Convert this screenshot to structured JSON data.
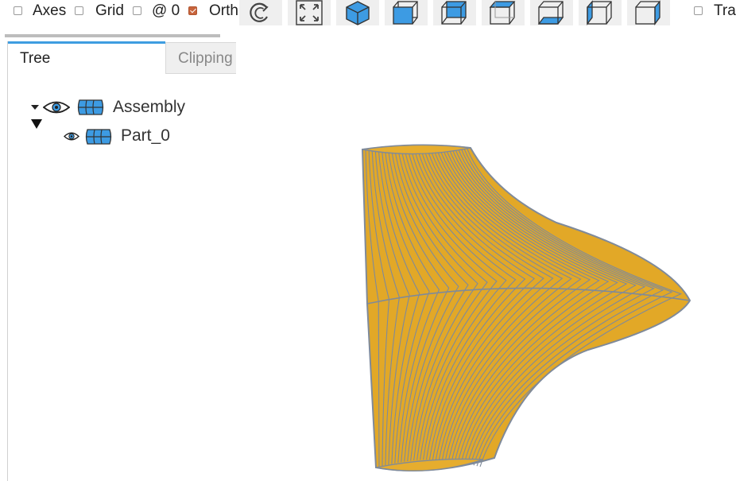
{
  "toolbar": {
    "checkboxes": [
      {
        "label": "Axes",
        "checked": false
      },
      {
        "label": "Grid",
        "checked": false
      },
      {
        "label": "@ 0",
        "checked": false
      },
      {
        "label": "Orth",
        "checked": true
      },
      {
        "label": "Tra",
        "checked": false
      }
    ],
    "buttons": [
      {
        "name": "reset-view-icon"
      },
      {
        "name": "fit-view-icon"
      },
      {
        "name": "isometric-view-icon"
      },
      {
        "name": "front-view-icon"
      },
      {
        "name": "rear-view-icon"
      },
      {
        "name": "top-view-icon"
      },
      {
        "name": "bottom-view-icon"
      },
      {
        "name": "left-view-icon"
      },
      {
        "name": "right-view-icon"
      }
    ]
  },
  "tabs": [
    {
      "label": "Tree",
      "active": true
    },
    {
      "label": "Clipping",
      "active": false
    }
  ],
  "tree": {
    "root": {
      "label": "Assembly",
      "expanded": true,
      "visible": true
    },
    "children": [
      {
        "label": "Part_0",
        "visible": true
      }
    ]
  },
  "colors": {
    "accent": "#3e9de0",
    "shape_fill": "#e2a827",
    "shape_edges": "#7f8a9a",
    "button_blue": "#3d9be3"
  }
}
